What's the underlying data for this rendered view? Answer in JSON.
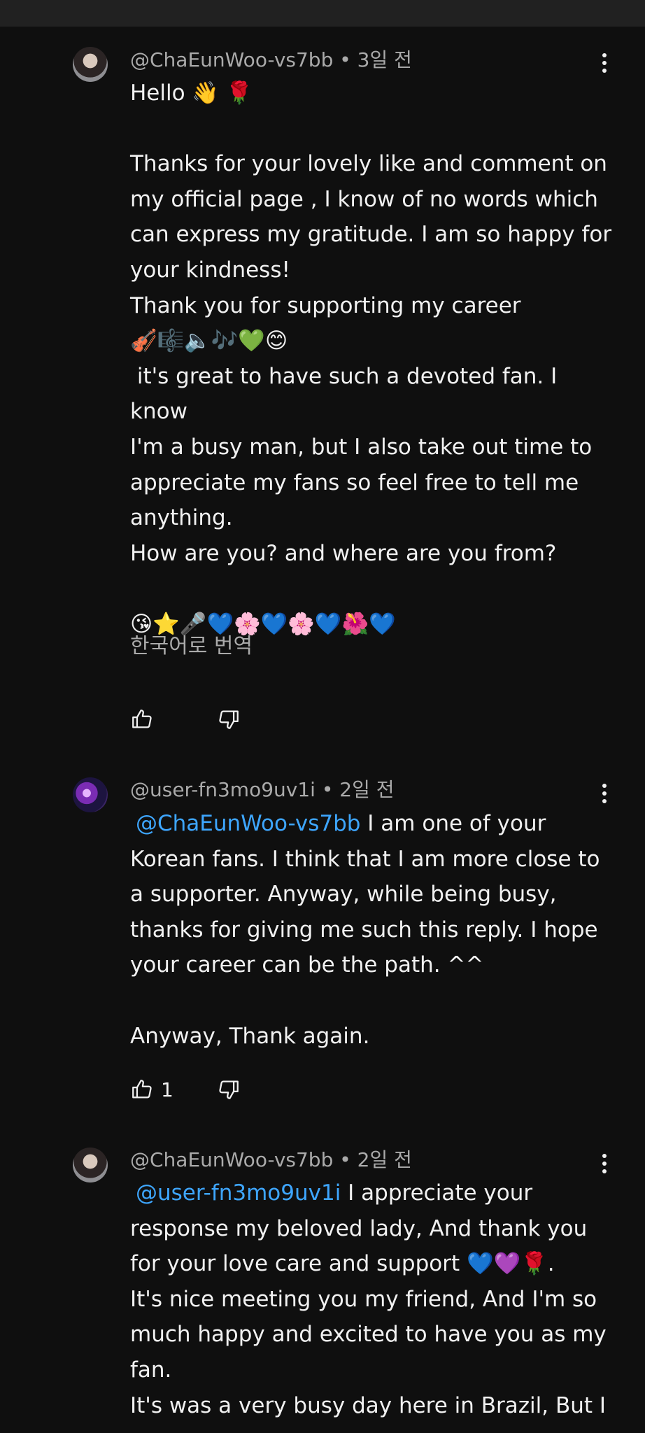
{
  "comments": [
    {
      "author": "@ChaEunWoo-vs7bb",
      "time": "3일 전",
      "lines": [
        "Hello 👋 🌹",
        "",
        "Thanks for your lovely like and comment on",
        "my official page , I know of no words which",
        "can express my gratitude. I am so happy for",
        "your kindness!",
        "Thank you for supporting my career",
        "🎻🎼🔈🎶💚😊",
        " it's great to have such a devoted fan. I know",
        "I'm a busy man, but I also take out time to",
        "appreciate my fans so feel free to tell me",
        "anything.",
        "How are you? and where are you from?",
        "",
        "😘⭐🎤💙🌸💙🌸💙🌺💙"
      ],
      "translate": "한국어로 번역",
      "likes": ""
    },
    {
      "author": "@user-fn3mo9uv1i",
      "time": "2일 전",
      "mention": "@ChaEunWoo-vs7bb",
      "first_line_rest": " I am one of your",
      "lines": [
        "Korean fans. I think that I am more close to",
        "a supporter. Anyway, while being busy,",
        "thanks for giving me such this reply. I hope",
        "your career can be the path. ^^",
        "",
        "Anyway, Thank again."
      ],
      "likes": "1"
    },
    {
      "author": "@ChaEunWoo-vs7bb",
      "time": "2일 전",
      "mention": "@user-fn3mo9uv1i",
      "first_line_rest": " I appreciate your",
      "lines": [
        "response my beloved lady, And thank you",
        "for your love care and support 💙💜🌹.",
        "It's nice meeting you my friend, And I'm so",
        "much happy and excited to have you as my",
        "fan.",
        "It's was a very busy day here in Brazil, But I"
      ]
    }
  ],
  "icons": {
    "like": "thumbs-up-icon",
    "dislike": "thumbs-down-icon",
    "more": "more-vertical-icon"
  }
}
